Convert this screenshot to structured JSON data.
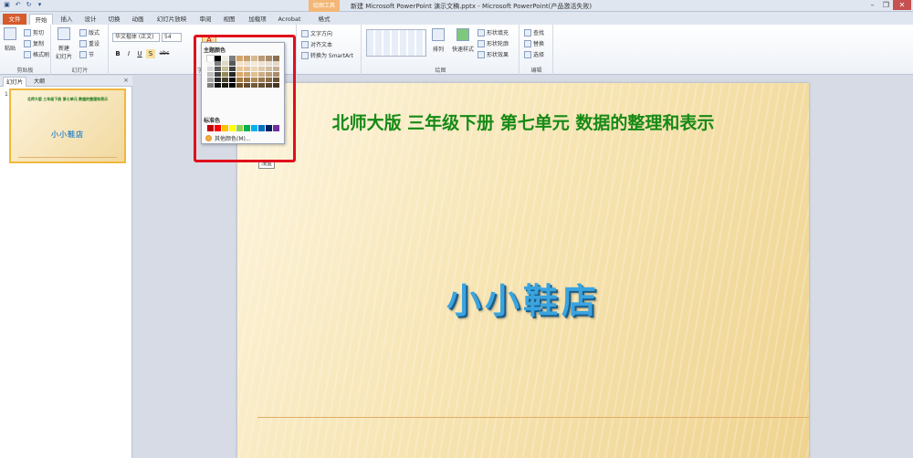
{
  "titlebar": {
    "quick_access": [
      "save-icon",
      "undo-icon",
      "redo-icon",
      "customize-icon"
    ],
    "context_tab": "绘图工具",
    "window_title": "新建 Microsoft PowerPoint 演示文稿.pptx  -  Microsoft PowerPoint(产品激活失败)",
    "controls": [
      "minimize",
      "restore",
      "close"
    ]
  },
  "tabs": [
    "文件",
    "开始",
    "插入",
    "设计",
    "切换",
    "动画",
    "幻灯片放映",
    "审阅",
    "视图",
    "加载项",
    "Acrobat",
    "格式"
  ],
  "ribbon": {
    "clipboard": {
      "label": "剪贴板",
      "paste": "粘贴",
      "cut": "剪切",
      "copy": "复制",
      "painter": "格式刷"
    },
    "slides": {
      "label": "幻灯片",
      "new_slide": "新建\n幻灯片",
      "layout": "版式",
      "reset": "重设",
      "section": "节"
    },
    "font": {
      "label": "字体",
      "font_name": "华文楷体 (正文)",
      "font_size": "54",
      "buttons": [
        "B",
        "I",
        "U",
        "S",
        "abc"
      ]
    },
    "paragraph": {
      "text_direction": "文字方向",
      "align_text": "对齐文本",
      "smartart": "转换为 SmartArt"
    },
    "drawing": {
      "label": "绘图",
      "arrange": "排列",
      "quick_styles": "快速样式",
      "fill": "形状填充",
      "outline": "形状轮廓",
      "effects": "形状效果"
    },
    "editing": {
      "label": "编辑",
      "find": "查找",
      "replace": "替换",
      "select": "选择"
    }
  },
  "panel": {
    "tabs": [
      "幻灯片",
      "大纲"
    ],
    "close": "×",
    "slide_number": "1",
    "thumb_title": "北师大版 三年级下册 第七单元 数据的整理和表示",
    "thumb_main": "小小鞋店"
  },
  "slide": {
    "title": "北师大版  三年级下册  第七单元  数据的整理和表示",
    "main": "小小鞋店"
  },
  "color_popup": {
    "theme_label": "主题颜色",
    "standard_label": "标准色",
    "more_colors": "其他颜色(M)...",
    "tooltip": "浅蓝",
    "theme_colors": [
      [
        "#ffffff",
        "#000000",
        "#eeece1",
        "#7f7f7f",
        "#d4a56b",
        "#c79d6d",
        "#d7b98f",
        "#b99b77",
        "#a78b6b",
        "#8c6f52"
      ],
      [
        "#f2f2f2",
        "#7f7f7f",
        "#ddd9c3",
        "#595959",
        "#f3e2c8",
        "#efdfcc",
        "#f5ead8",
        "#eee4d6",
        "#e8ddd0",
        "#e3d6c8"
      ],
      [
        "#d9d9d9",
        "#595959",
        "#c4bd97",
        "#404040",
        "#e8c694",
        "#e2c39c",
        "#ebd6b3",
        "#dcc9ad",
        "#d3bea3",
        "#c7ae92"
      ],
      [
        "#bfbfbf",
        "#404040",
        "#938953",
        "#262626",
        "#dba96a",
        "#d2a775",
        "#e0c18c",
        "#cbad85",
        "#bd9e7a",
        "#ab8a66"
      ],
      [
        "#a5a5a5",
        "#262626",
        "#494429",
        "#0d0d0d",
        "#a77a3f",
        "#9c7346",
        "#ae8a55",
        "#98774d",
        "#886a48",
        "#6a4f35"
      ],
      [
        "#7f7f7f",
        "#0d0d0d",
        "#1d1b10",
        "#000000",
        "#6f5129",
        "#684d2f",
        "#745c39",
        "#654f34",
        "#5a4630",
        "#463423"
      ]
    ],
    "standard_colors": [
      "#c00000",
      "#ff0000",
      "#ffc000",
      "#ffff00",
      "#92d050",
      "#00b050",
      "#00b0f0",
      "#0070c0",
      "#002060",
      "#7030a0"
    ]
  },
  "colors": {
    "accent_highlight": "#e0101c",
    "slide_title": "#168a16",
    "slide_main": "#3aa4e0",
    "file_tab": "#d65a2c"
  }
}
